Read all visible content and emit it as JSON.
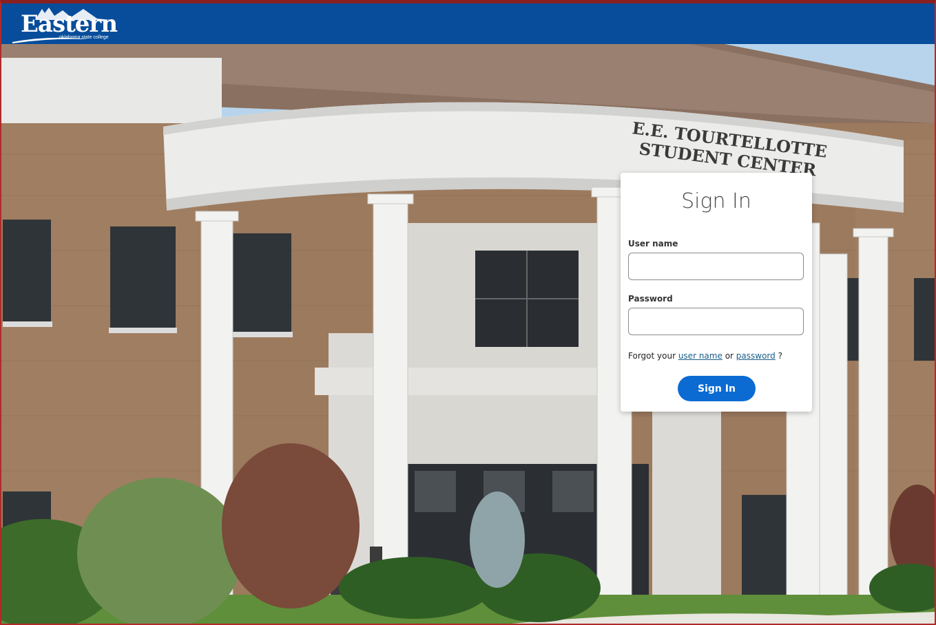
{
  "header": {
    "logo_text": "Eastern",
    "logo_subtext": "oklahoma state college"
  },
  "background": {
    "building_sign_line1": "E.E. TOURTELLOTTE",
    "building_sign_line2": "STUDENT CENTER"
  },
  "signin": {
    "title": "Sign In",
    "username_label": "User name",
    "username_value": "",
    "password_label": "Password",
    "password_value": "",
    "forgot_prefix": "Forgot your",
    "forgot_username_link": "user name",
    "forgot_or": "or",
    "forgot_password_link": "password",
    "forgot_suffix": "?",
    "submit_label": "Sign In"
  },
  "colors": {
    "header": "#074d9b",
    "button": "#0b6bd3",
    "link": "#1a5e8a"
  }
}
